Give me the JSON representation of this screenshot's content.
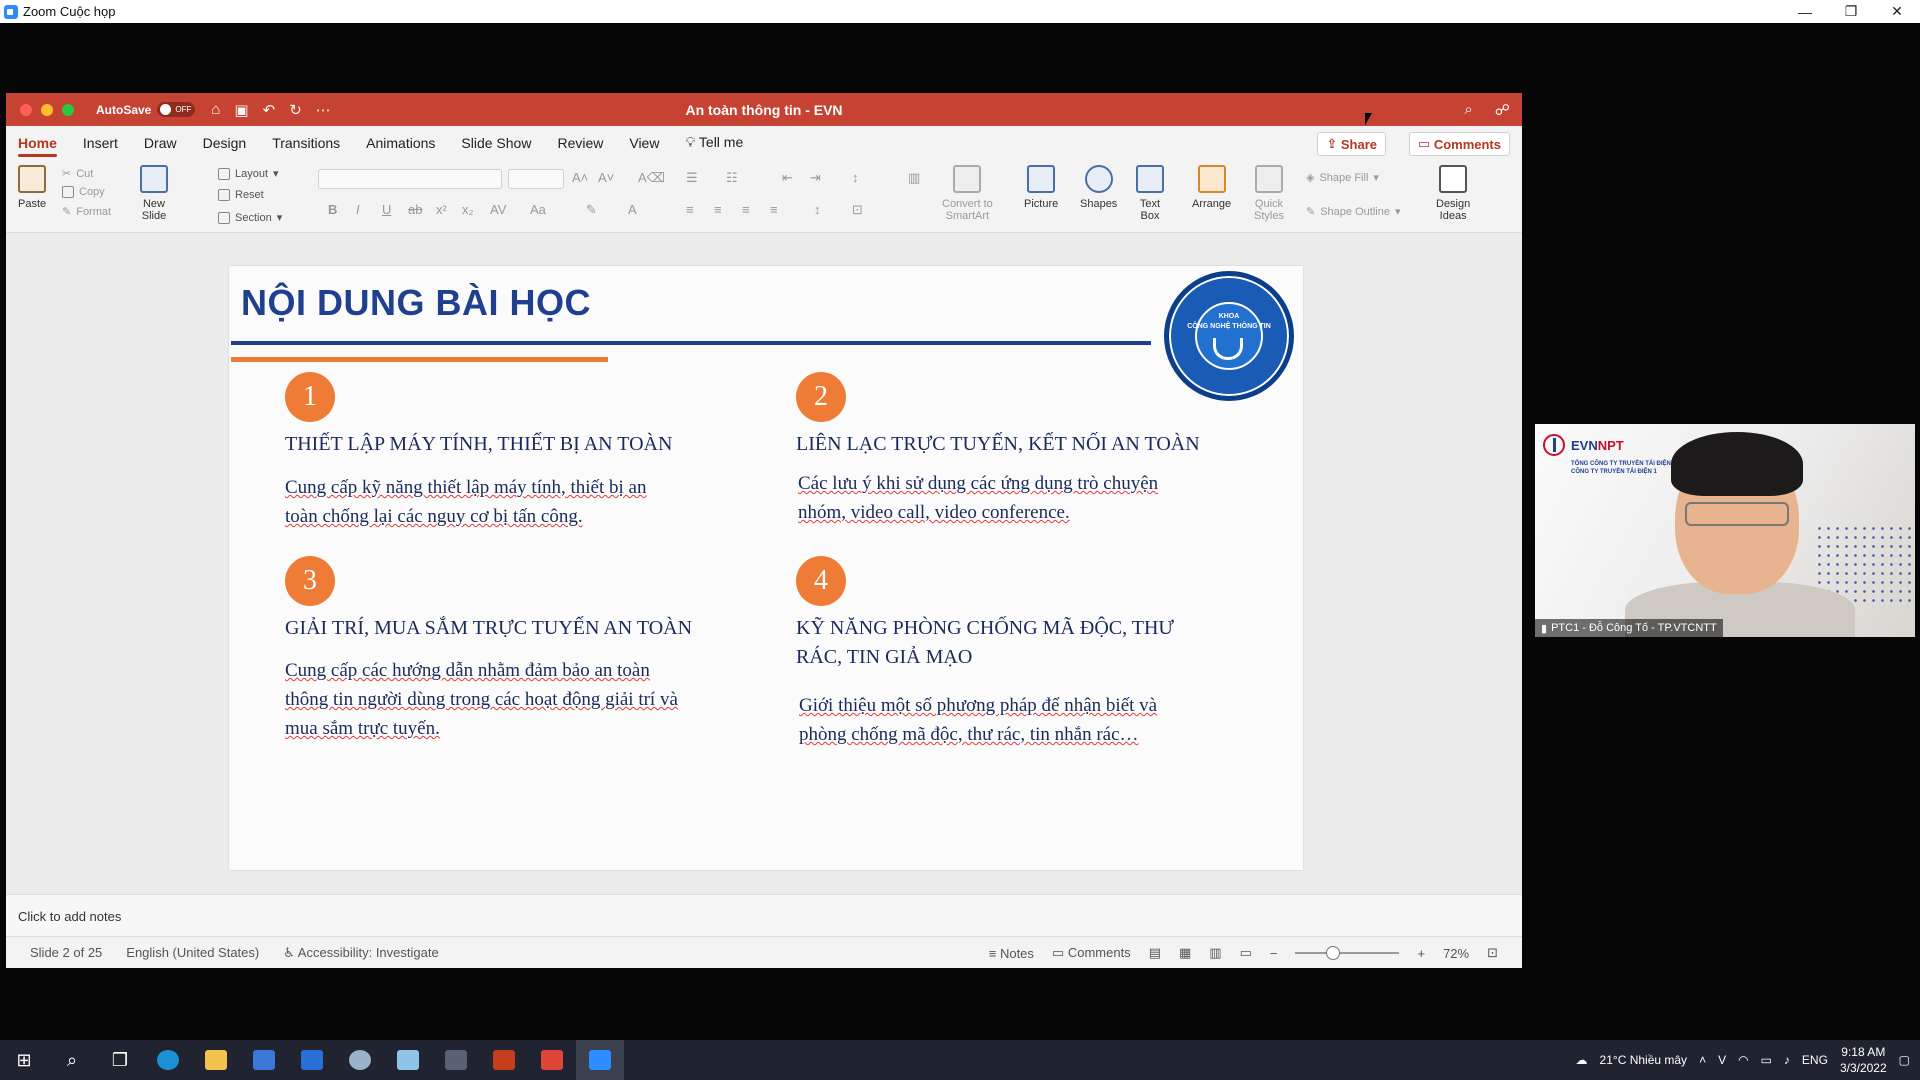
{
  "zoom": {
    "title": "Zoom Cuộc họp"
  },
  "window_controls": {
    "minimize": "—",
    "restore": "❐",
    "close": "✕"
  },
  "ppt": {
    "autosave_label": "AutoSave",
    "autosave_state": "OFF",
    "doc_title": "An toàn thông tin - EVN",
    "tabs": [
      "Home",
      "Insert",
      "Draw",
      "Design",
      "Transitions",
      "Animations",
      "Slide Show",
      "Review",
      "View",
      "Tell me"
    ],
    "share": "Share",
    "comments": "Comments",
    "ribbon": {
      "paste": "Paste",
      "cut": "Cut",
      "copy": "Copy",
      "format": "Format",
      "new_slide": [
        "New",
        "Slide"
      ],
      "layout": "Layout",
      "reset": "Reset",
      "section": "Section",
      "convert": [
        "Convert to",
        "SmartArt"
      ],
      "picture": "Picture",
      "shapes": "Shapes",
      "text_box": [
        "Text",
        "Box"
      ],
      "arrange": "Arrange",
      "quick_styles": [
        "Quick",
        "Styles"
      ],
      "shape_fill": "Shape Fill",
      "shape_outline": "Shape Outline",
      "design_ideas": [
        "Design",
        "Ideas"
      ]
    }
  },
  "slide": {
    "title": "NỘI DUNG BÀI HỌC",
    "logo_text": [
      "KHOA",
      "CÔNG NGHỆ THÔNG TIN"
    ],
    "items": [
      {
        "num": "1",
        "title": "THIẾT LẬP MÁY TÍNH, THIẾT BỊ AN TOÀN",
        "desc": [
          "Cung cấp kỹ năng thiết lập máy tính, thiết bị an",
          "toàn chống lại các nguy cơ bị tấn công."
        ]
      },
      {
        "num": "2",
        "title": "LIÊN LẠC TRỰC TUYẾN, KẾT NỐI AN TOÀN",
        "desc": [
          "Các lưu ý khi sử dụng các ứng dụng trò chuyện",
          "nhóm, video call, video conference."
        ]
      },
      {
        "num": "3",
        "title": "GIẢI TRÍ, MUA SẮM TRỰC TUYẾN AN TOÀN",
        "desc": [
          "Cung cấp các hướng dẫn nhằm đảm bảo an toàn",
          "thông tin người dùng trong các hoạt động giải trí và",
          "mua sắm trực tuyến."
        ]
      },
      {
        "num": "4",
        "title": [
          "KỸ NĂNG PHÒNG CHỐNG MÃ ĐỘC, THƯ",
          "RÁC, TIN GIẢ MẠO"
        ],
        "desc": [
          "Giới thiệu một số phương pháp để nhận biết và",
          "phòng chống mã độc, thư rác, tin nhắn rác…"
        ]
      }
    ]
  },
  "notes": {
    "placeholder": "Click to add notes"
  },
  "status": {
    "slide": "Slide 2 of 25",
    "language": "English (United States)",
    "accessibility": "Accessibility: Investigate",
    "notes": "Notes",
    "comments": "Comments",
    "zoom": "72%",
    "zoom_level": 0.36
  },
  "video": {
    "participant": "PTC1 - Đỗ Công Tố - TP.VTCNTT",
    "logo_main": "EVN",
    "logo_accent": "NPT",
    "logo_sub": [
      "TỔNG CÔNG TY TRUYỀN TẢI ĐIỆN",
      "CÔNG TY TRUYỀN TẢI ĐIỆN 1"
    ]
  },
  "taskbar": {
    "weather": "21°C  Nhiều mây",
    "lang": "ENG",
    "time": "9:18 AM",
    "date": "3/3/2022"
  },
  "colors": {
    "ppt_accent": "#c64232",
    "slide_title": "#1f3f8f",
    "number_badge": "#ee7b36"
  }
}
